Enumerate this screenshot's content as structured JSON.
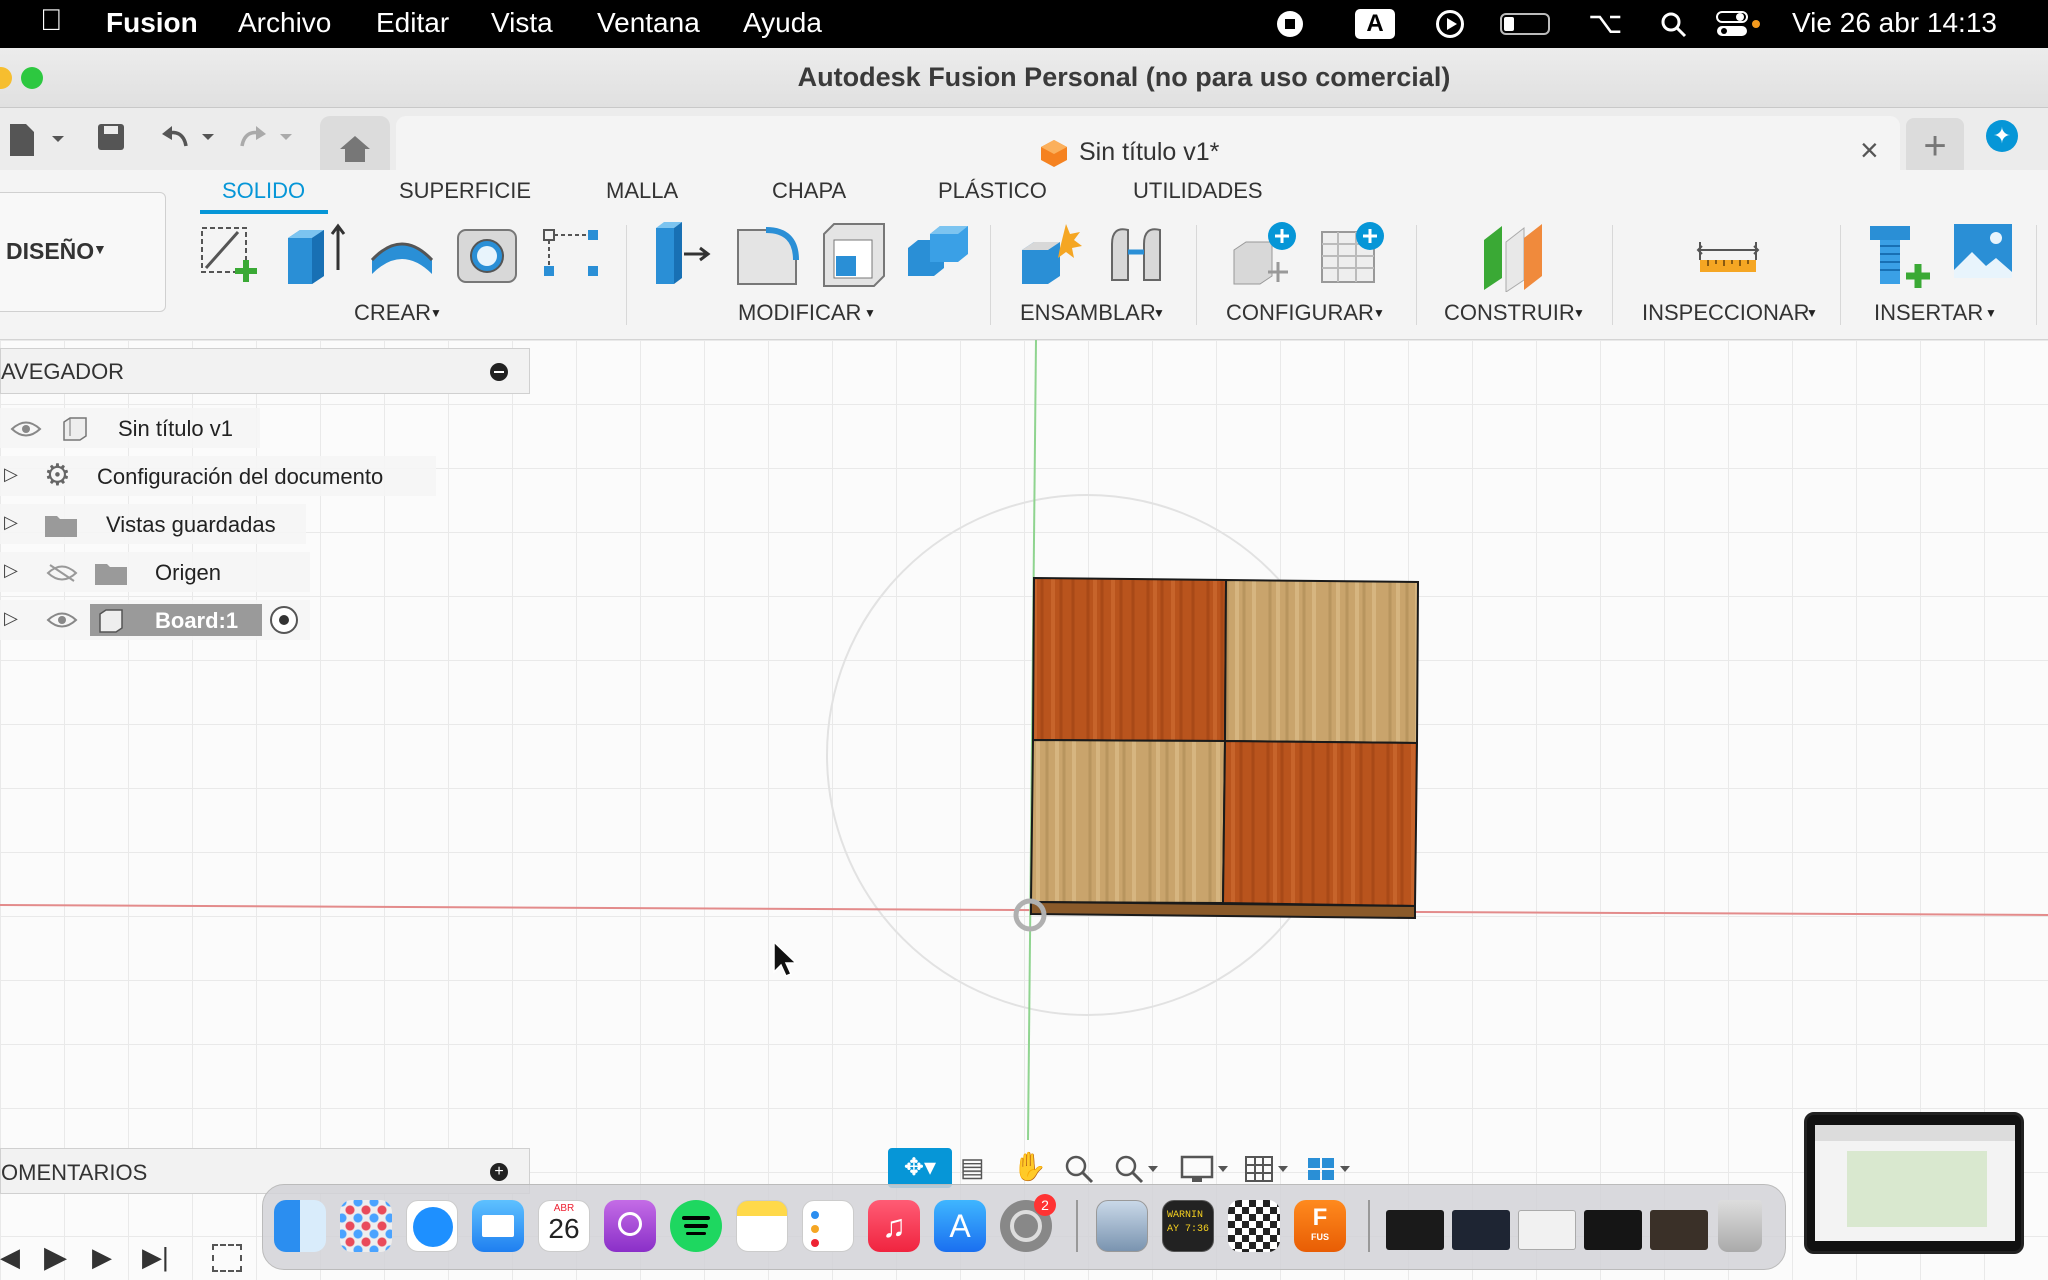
{
  "menubar": {
    "apple_icon": "apple-logo-icon",
    "items": [
      "Fusion",
      "Archivo",
      "Editar",
      "Vista",
      "Ventana",
      "Ayuda"
    ],
    "status_icons": [
      "stop-recording-icon",
      "input-source-icon",
      "play-icon",
      "battery-icon",
      "wifi-icon",
      "spotlight-search-icon",
      "control-center-icon"
    ],
    "input_source": "A",
    "clock": "Vie 26 abr  14:13"
  },
  "window": {
    "title": "Autodesk Fusion Personal (no para uso comercial)"
  },
  "document_tab": {
    "title": "Sin título v1*",
    "close_icon": "close-icon"
  },
  "ribbon": {
    "tabs": [
      "SOLIDO",
      "SUPERFICIE",
      "MALLA",
      "CHAPA",
      "PLÁSTICO",
      "UTILIDADES"
    ],
    "active_tab": "SOLIDO",
    "workspace": "DISEÑO",
    "groups": [
      "CREAR",
      "MODIFICAR",
      "ENSAMBLAR",
      "CONFIGURAR",
      "CONSTRUIR",
      "INSPECCIONAR",
      "INSERTAR"
    ]
  },
  "browser": {
    "title": "AVEGADOR",
    "items": [
      {
        "label": "Sin título v1",
        "icon": "component-icon"
      },
      {
        "label": "Configuración del documento",
        "icon": "gear-icon"
      },
      {
        "label": "Vistas guardadas",
        "icon": "folder-icon"
      },
      {
        "label": "Origen",
        "icon": "folder-icon"
      },
      {
        "label": "Board:1",
        "icon": "body-icon"
      }
    ]
  },
  "comments": {
    "title": "OMENTARIOS"
  },
  "colors": {
    "accent": "#0696d7",
    "wood_dark": "#b9541d",
    "wood_light": "#c9a46c",
    "x_axis": "#e38b8b",
    "y_axis": "#8fd48f"
  },
  "dock": {
    "calendar_month": "ABR",
    "calendar_day": "26",
    "settings_badge": "2",
    "console_text": "WARNIN\nAY 7:36",
    "fusion_label": "FUS",
    "apps": [
      "finder-icon",
      "launchpad-icon",
      "safari-icon",
      "mail-icon",
      "calendar-icon",
      "podcasts-icon",
      "spotify-icon",
      "notes-icon",
      "reminders-icon",
      "music-icon",
      "app-store-icon",
      "system-settings-icon",
      "preview-icon",
      "console-icon",
      "chess-icon",
      "fusion-icon"
    ]
  }
}
